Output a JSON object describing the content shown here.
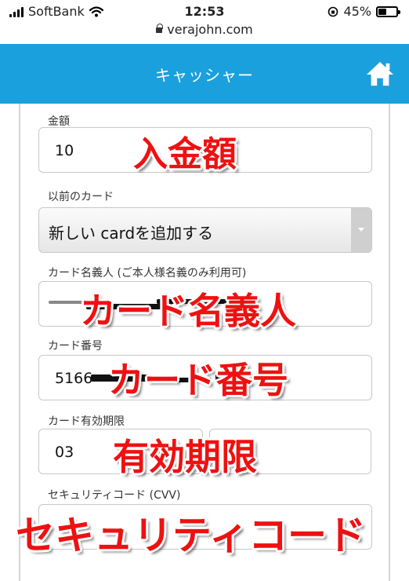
{
  "status_bar": {
    "carrier": "SoftBank",
    "time": "12:53",
    "battery_percent": "45%",
    "battery_level": 0.45
  },
  "browser": {
    "url": "verajohn.com"
  },
  "header": {
    "title": "キャッシャー",
    "home_icon": "home-icon"
  },
  "form": {
    "amount": {
      "label": "金額",
      "value": "10"
    },
    "previous_card": {
      "label": "以前のカード",
      "selected": "新しい cardを追加する"
    },
    "cardholder": {
      "label": "カード名義人 (ご本人様名義のみ利用可)"
    },
    "card_number": {
      "label": "カード番号",
      "value_visible": "5166"
    },
    "expiry": {
      "label": "カード有効期限",
      "month": "03"
    },
    "cvv": {
      "label": "セキュリティコード (CVV)"
    }
  },
  "annotations": {
    "amount": "入金額",
    "cardholder": "カード名義人",
    "card_number": "カード番号",
    "expiry": "有効期限",
    "cvv": "セキュリティコード"
  },
  "colors": {
    "header_blue": "#1aa0dd",
    "annotation_red": "#ee1111"
  }
}
